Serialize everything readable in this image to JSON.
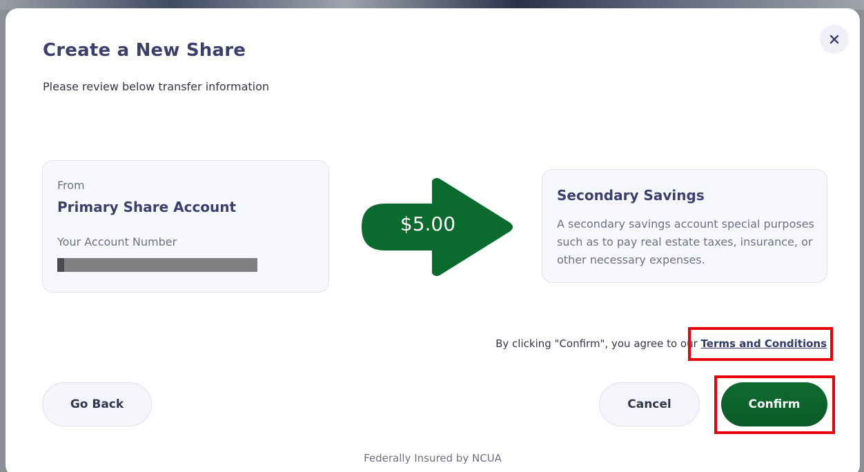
{
  "modal": {
    "title": "Create a New Share",
    "subtitle": "Please review below transfer information"
  },
  "from_card": {
    "label": "From",
    "account_name": "Primary Share Account",
    "account_number_label": "Your Account Number"
  },
  "transfer": {
    "amount": "$5.00",
    "arrow_color": "#0b6b2e"
  },
  "to_card": {
    "account_name": "Secondary Savings",
    "description": "A secondary savings account special purposes such as to pay real estate taxes, insurance, or other necessary expenses."
  },
  "terms": {
    "prefix": "By clicking \"Confirm\", you agree to our ",
    "link_label": "Terms and Conditions"
  },
  "buttons": {
    "go_back": "Go Back",
    "cancel": "Cancel",
    "confirm": "Confirm"
  },
  "footer": {
    "text": "Federally Insured by NCUA"
  },
  "icons": {
    "close": "close-icon",
    "arrow": "arrow-right-icon"
  },
  "colors": {
    "brand_green": "#0b6b2e",
    "title_navy": "#3b3f6b",
    "highlight_red": "#e8000b"
  }
}
